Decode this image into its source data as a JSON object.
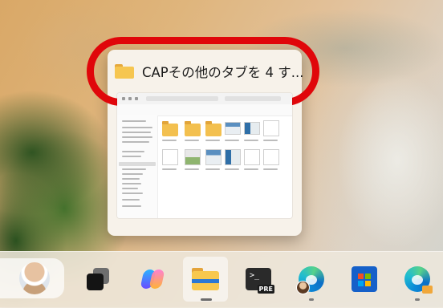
{
  "thumbnail": {
    "title": "CAPその他のタブを 4 す..."
  },
  "taskbar": {
    "items": [
      {
        "name": "widgets",
        "icon": "avatar-icon",
        "running": false
      },
      {
        "name": "task-view",
        "icon": "task-view-icon",
        "running": false
      },
      {
        "name": "copilot",
        "icon": "copilot-icon",
        "running": false
      },
      {
        "name": "file-explorer",
        "icon": "folder-icon",
        "running": true,
        "active": true
      },
      {
        "name": "terminal-preview",
        "icon": "terminal-icon",
        "badge": "PRE",
        "running": false
      },
      {
        "name": "edge-profile",
        "icon": "edge-icon",
        "running": true
      },
      {
        "name": "microsoft-store",
        "icon": "store-icon",
        "running": false
      },
      {
        "name": "edge-work",
        "icon": "edge-icon",
        "running": true
      }
    ]
  },
  "colors": {
    "highlight": "#e0060a",
    "folder": "#f6c650",
    "store": "#1560c9"
  }
}
